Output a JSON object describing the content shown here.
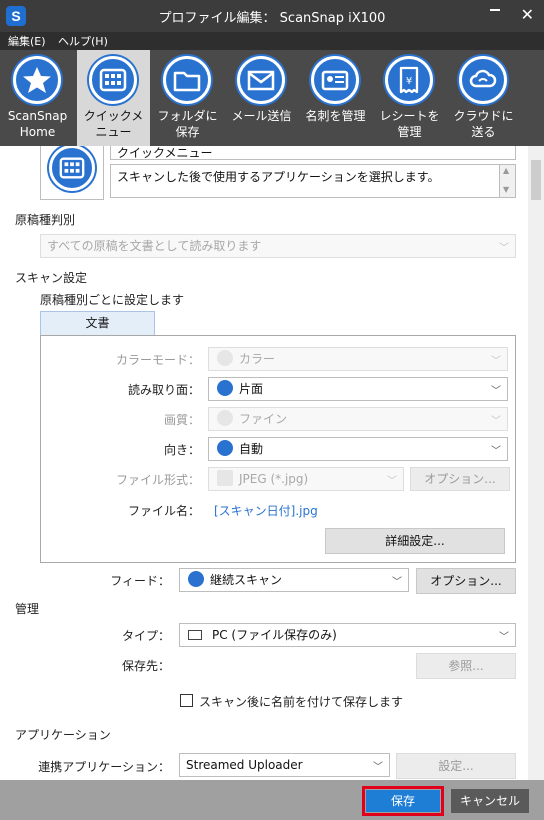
{
  "window": {
    "title": "プロファイル編集： ScanSnap iX100",
    "logo": "S"
  },
  "menu": {
    "edit": "編集(E)",
    "help": "ヘルプ(H)"
  },
  "toolbar": {
    "items": [
      {
        "label": "ScanSnap\nHome",
        "icon": "star-icon"
      },
      {
        "label": "クイックメ\nニュー",
        "icon": "grid-icon"
      },
      {
        "label": "フォルダに\n保存",
        "icon": "folder-icon"
      },
      {
        "label": "メール送信",
        "icon": "mail-icon"
      },
      {
        "label": "名刺を管理",
        "icon": "business-card-icon"
      },
      {
        "label": "レシートを\n管理",
        "icon": "receipt-icon"
      },
      {
        "label": "クラウドに\n送る",
        "icon": "cloud-icon"
      }
    ],
    "active_index": 1
  },
  "profile": {
    "name": "クイックメニュー",
    "description": "スキャンした後で使用するアプリケーションを選択します。"
  },
  "doc_type": {
    "heading": "原稿種判別",
    "value": "すべての原稿を文書として読み取ります"
  },
  "scan_settings": {
    "heading": "スキャン設定",
    "subheading": "原稿種別ごとに設定します",
    "tab": "文書",
    "color_mode": {
      "label": "カラーモード：",
      "value": "カラー"
    },
    "scan_side": {
      "label": "読み取り面：",
      "value": "片面"
    },
    "quality": {
      "label": "画質：",
      "value": "ファイン"
    },
    "orientation": {
      "label": "向き：",
      "value": "自動"
    },
    "file_format": {
      "label": "ファイル形式：",
      "value": "JPEG (*.jpg)",
      "option_button": "オプション..."
    },
    "file_name": {
      "label": "ファイル名：",
      "value": "[スキャン日付].jpg"
    },
    "detail_button": "詳細設定...",
    "feed": {
      "label": "フィード：",
      "value": "継続スキャン",
      "option_button": "オプション..."
    }
  },
  "management": {
    "heading": "管理",
    "type": {
      "label": "タイプ：",
      "value": "PC (ファイル保存のみ)"
    },
    "destination": {
      "label": "保存先：",
      "browse_button": "参照..."
    },
    "rename_checkbox": {
      "label": "スキャン後に名前を付けて保存します",
      "checked": false
    }
  },
  "application": {
    "heading": "アプリケーション",
    "linked": {
      "label": "連携アプリケーション：",
      "value": "Streamed Uploader",
      "settings_button": "設定..."
    }
  },
  "footer": {
    "save": "保存",
    "cancel": "キャンセル"
  },
  "colors": {
    "accent": "#2a72d0",
    "titlebar": "#3c3c3c",
    "toolbar": "#4a4a4a",
    "save_highlight": "#e0001b",
    "link": "#2a72d0"
  }
}
